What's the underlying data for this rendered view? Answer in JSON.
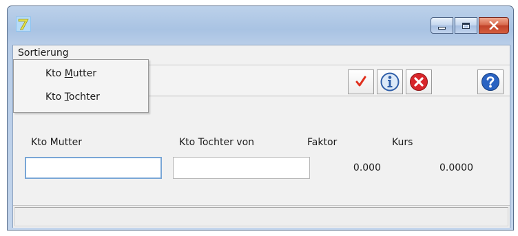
{
  "window": {
    "title": ""
  },
  "menubar": {
    "items": [
      {
        "label": "Sortierung"
      }
    ]
  },
  "dropdown": {
    "items": [
      {
        "pre": "Kto ",
        "accel": "M",
        "post": "utter"
      },
      {
        "pre": "Kto ",
        "accel": "T",
        "post": "ochter"
      }
    ]
  },
  "toolbar": {
    "buttons": [
      {
        "icon": "checkmark-icon",
        "color": "#e0301e"
      },
      {
        "icon": "info-icon",
        "color": "#2f5ea8"
      },
      {
        "icon": "cancel-x-icon",
        "color": "#d8262b"
      },
      {
        "icon": "help-icon",
        "color": "#2258b8"
      }
    ]
  },
  "form": {
    "kto_mutter": {
      "label": "Kto Mutter",
      "value": ""
    },
    "kto_tochter_von": {
      "label": "Kto Tochter von",
      "value": ""
    },
    "faktor": {
      "label": "Faktor",
      "value": "0.000"
    },
    "kurs": {
      "label": "Kurs",
      "value": "0.0000"
    }
  },
  "statusbar": {
    "text": ""
  }
}
